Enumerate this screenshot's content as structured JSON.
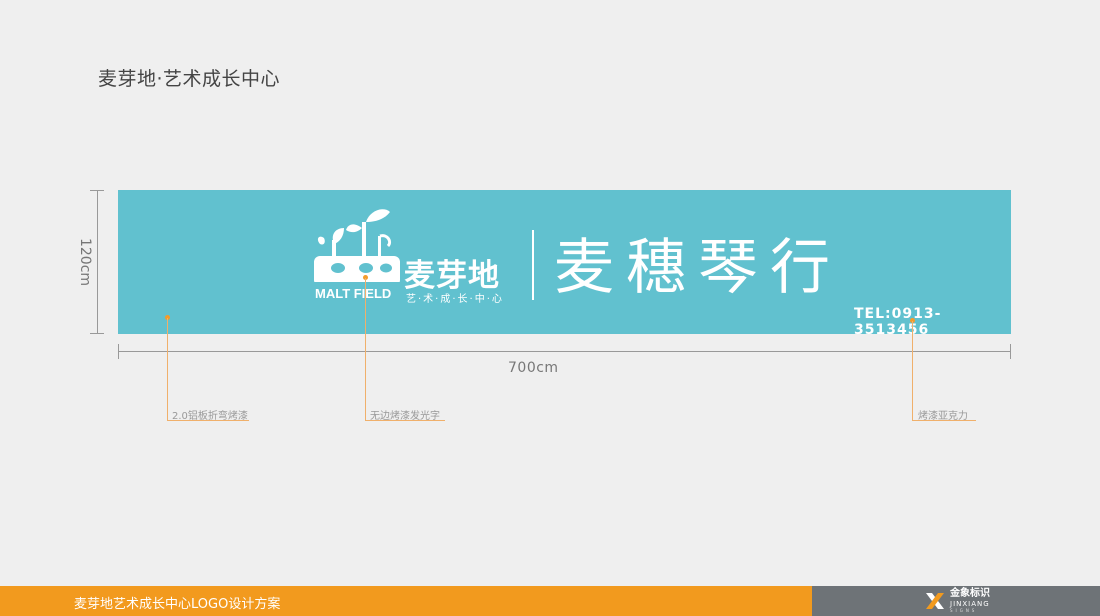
{
  "page_title": "麦芽地·艺术成长中心",
  "dimensions": {
    "height": "120cm",
    "width": "700cm"
  },
  "sign": {
    "brand_en": "MALT FIELD",
    "brand_cn": "麦芽地",
    "brand_sub": "艺·术·成·长·中·心",
    "shop_name": "麦穗琴行",
    "tel": "TEL:0913-3513456",
    "bg_color": "#61c1cf"
  },
  "callouts": [
    {
      "label": "2.0铝板折弯烤漆"
    },
    {
      "label": "无边烤漆发光字"
    },
    {
      "label": "烤漆亚克力"
    }
  ],
  "footer": {
    "title": "麦芽地艺术成长中心LOGO设计方案",
    "company_cn": "金象标识",
    "company_en": "JINXIANG",
    "company_en_sub": "SIGNS",
    "accent_color": "#f29a1e",
    "dark_color": "#6e7377"
  }
}
